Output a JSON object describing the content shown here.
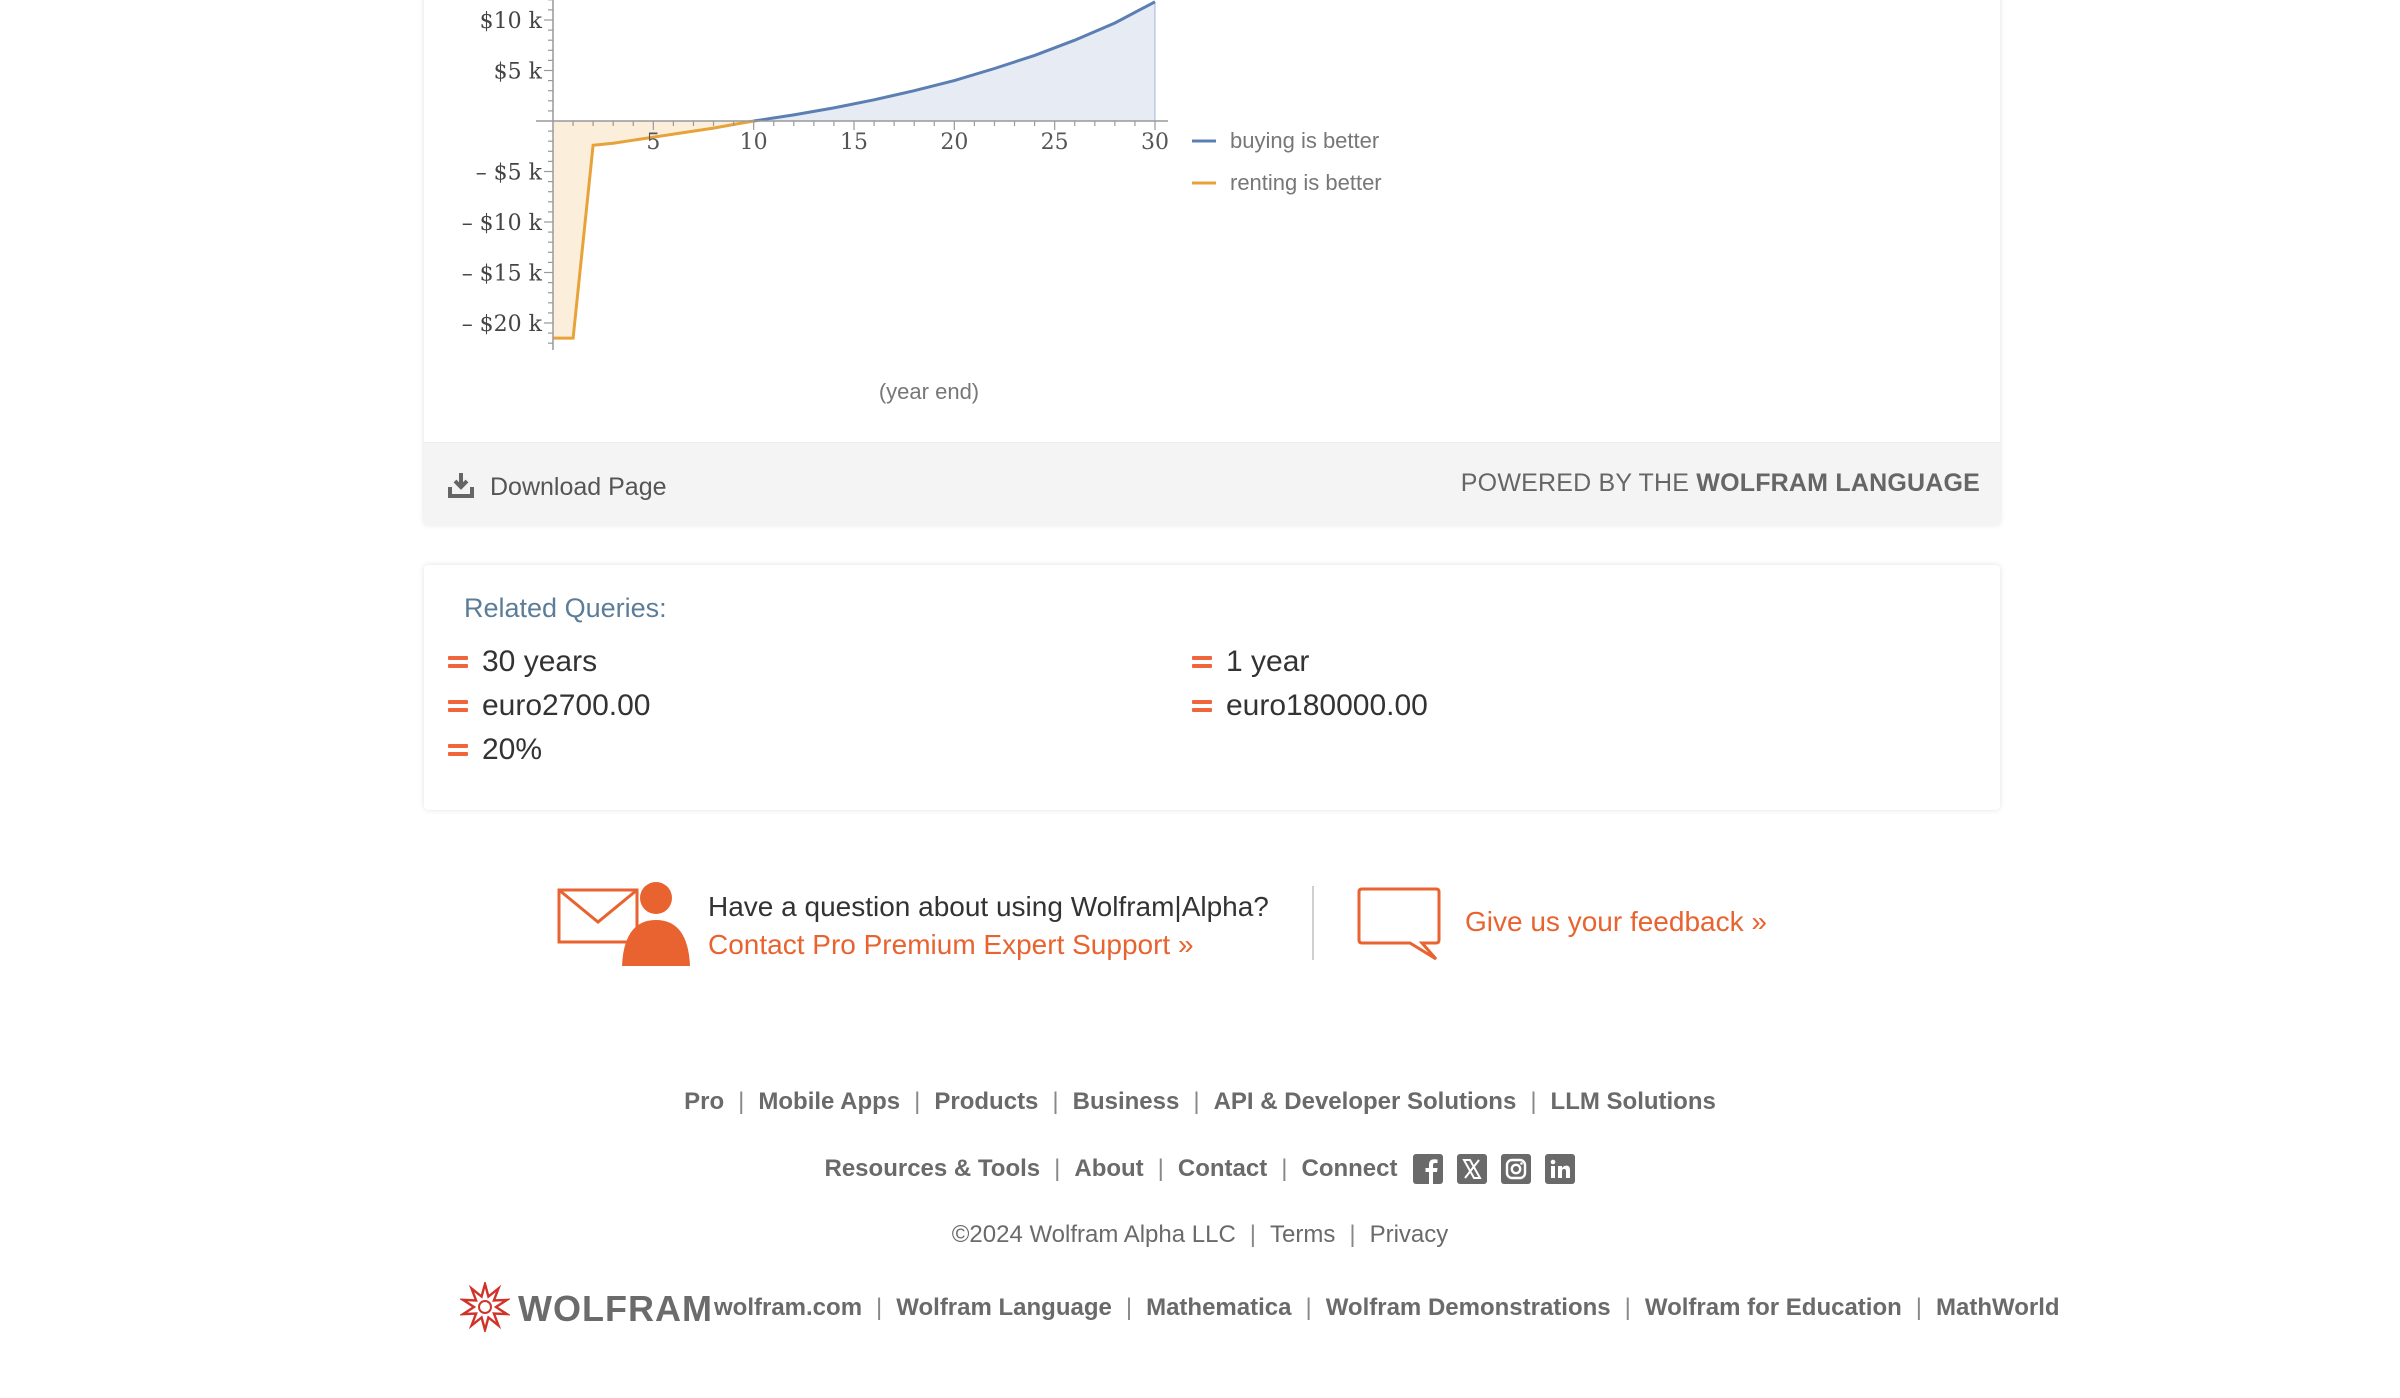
{
  "chart_data": {
    "type": "area",
    "x_ticks": [
      "5",
      "10",
      "15",
      "20",
      "25",
      "30"
    ],
    "y_ticks": [
      "$10 k",
      "$5 k",
      "– $5 k",
      "– $10 k",
      "– $15 k",
      "– $20 k"
    ],
    "xlabel": "(year end)",
    "xlim": [
      0,
      30
    ],
    "ylim": [
      -23000,
      12000
    ],
    "series": [
      {
        "name": "buying is better",
        "color": "#5b7fb3",
        "fill": "#e6ebf4",
        "x": [
          10,
          12,
          14,
          16,
          18,
          20,
          22,
          24,
          26,
          28,
          30
        ],
        "y": [
          0,
          600,
          1300,
          2100,
          3000,
          4000,
          5200,
          6500,
          8000,
          9700,
          11800
        ]
      },
      {
        "name": "renting is better",
        "color": "#e8a23a",
        "fill": "#fbefdc",
        "x": [
          0,
          1,
          2,
          3,
          4,
          5,
          6,
          7,
          8,
          9,
          10
        ],
        "y": [
          -21500,
          -21500,
          -2400,
          -2200,
          -1900,
          -1600,
          -1300,
          -1000,
          -700,
          -350,
          0
        ]
      }
    ],
    "legend": "right"
  },
  "result": {
    "download_label": "Download Page",
    "powered_by_prefix": "POWERED BY THE",
    "powered_by_brand": "WOLFRAM LANGUAGE"
  },
  "related": {
    "title": "Related Queries:",
    "items": [
      "30 years",
      "euro2700.00",
      "20%",
      "1 year",
      "euro180000.00"
    ]
  },
  "support": {
    "question": "Have a question about using Wolfram|Alpha?",
    "link": "Contact Pro Premium Expert Support »",
    "feedback": "Give us your feedback »"
  },
  "footer": {
    "row1": [
      "Pro",
      "Mobile Apps",
      "Products",
      "Business",
      "API & Developer Solutions",
      "LLM Solutions"
    ],
    "row2": [
      "Resources & Tools",
      "About",
      "Contact",
      "Connect"
    ],
    "social_icons": [
      "facebook-icon",
      "x-twitter-icon",
      "instagram-icon",
      "linkedin-icon"
    ],
    "copyright": "©2024  Wolfram Alpha LLC",
    "terms": "Terms",
    "privacy": "Privacy",
    "logo_text": "WOLFRAM",
    "bottom_links": [
      "wolfram.com",
      "Wolfram Language",
      "Mathematica",
      "Wolfram Demonstrations",
      "Wolfram for Education",
      "MathWorld"
    ]
  },
  "colors": {
    "accent": "#e8632f",
    "related_title": "#5b7d98"
  }
}
